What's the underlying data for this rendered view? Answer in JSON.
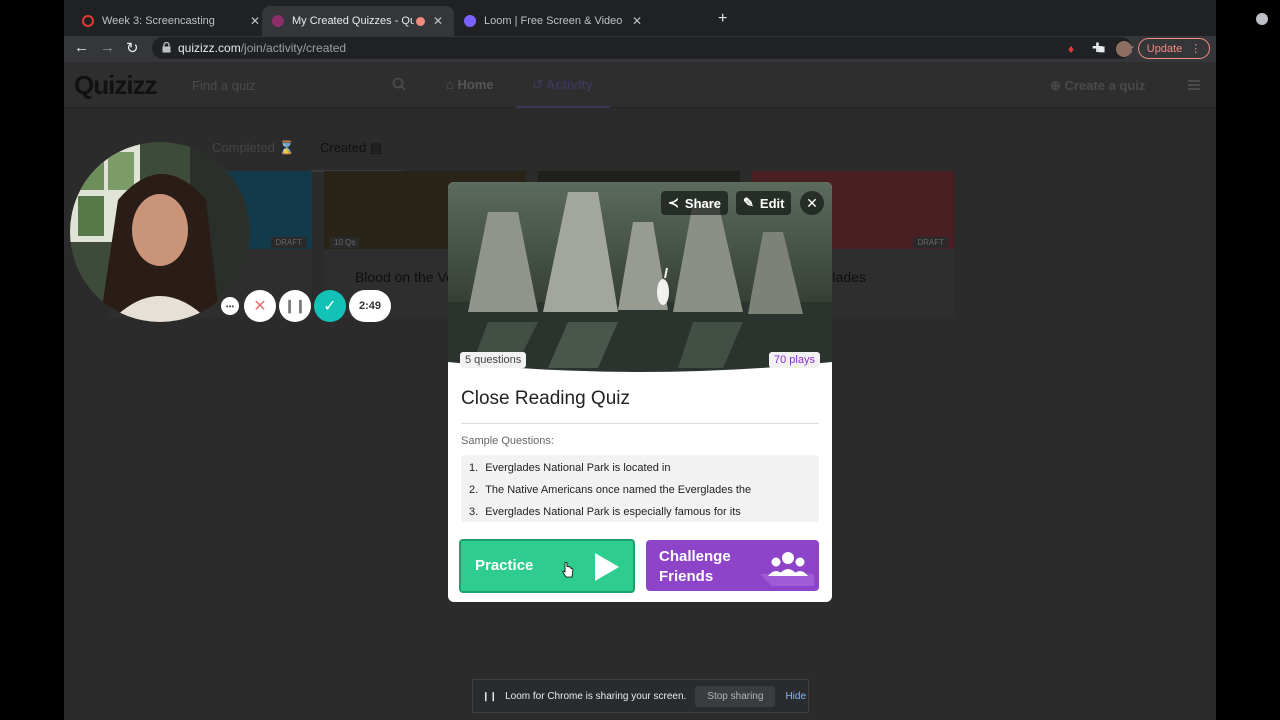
{
  "tabs": [
    {
      "title": "Week 3: Screencasting",
      "active": false
    },
    {
      "title": "My Created Quizzes - Quiz",
      "active": true
    },
    {
      "title": "Loom | Free Screen & Video Re",
      "active": false
    }
  ],
  "toolbar": {
    "url_host": "quizizz.com",
    "url_path": "/join/activity/created",
    "update_label": "Update"
  },
  "header": {
    "logo": "Quizizz",
    "search_placeholder": "Find a quiz",
    "nav": [
      "Home",
      "Activity"
    ],
    "create_label": "Create a quiz"
  },
  "subtabs": {
    "completed": "Completed",
    "created": "Created"
  },
  "cards": [
    {
      "badge": "DRAFT",
      "title": ""
    },
    {
      "badge": "10 Qs",
      "title": "Blood on the Vocabula"
    },
    {
      "badge": "",
      "title": ""
    },
    {
      "badge": "DRAFT",
      "title": "Everglades"
    }
  ],
  "modal": {
    "share_label": "Share",
    "edit_label": "Edit",
    "questions_count": "5 questions",
    "plays": "70 plays",
    "title": "Close Reading Quiz",
    "sample_label": "Sample Questions:",
    "samples": [
      {
        "num": "1.",
        "text": "Everglades National Park is located in"
      },
      {
        "num": "2.",
        "text": "The Native Americans once named the Everglades the"
      },
      {
        "num": "3.",
        "text": "Everglades National Park is especially famous for its"
      }
    ],
    "practice_label": "Practice",
    "challenge_line1": "Challenge",
    "challenge_line2": "Friends"
  },
  "loom": {
    "timer": "2:49",
    "share_message": "Loom for Chrome is sharing your screen.",
    "stop_label": "Stop sharing",
    "hide_label": "Hide"
  },
  "colors": {
    "practice": "#2ecc8f",
    "challenge": "#8e44c9",
    "loom_teal": "#13c2b6",
    "update": "#f28b82"
  }
}
